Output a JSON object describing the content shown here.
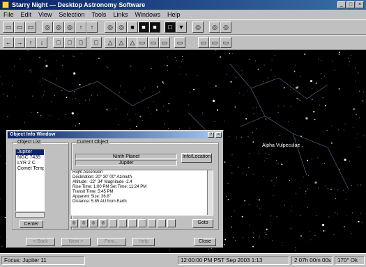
{
  "window": {
    "title": "Starry Night — Desktop Astronomy Software"
  },
  "menu": [
    "File",
    "Edit",
    "View",
    "Selection",
    "Tools",
    "Links",
    "Windows",
    "Help"
  ],
  "toolbar1": [
    "▭",
    "▭",
    "▭",
    "◎",
    "◎",
    "◎",
    "↑",
    "↑",
    "◎",
    "◎",
    "■",
    "■",
    "■",
    "□",
    "▼",
    "◎",
    "◎",
    "◎"
  ],
  "toolbar2": [
    "←",
    "→",
    "↑",
    "↓",
    "□",
    "□",
    "□",
    "□",
    "△",
    "△",
    "△",
    "▭",
    "▭",
    "▭",
    "▭",
    "▭",
    "▭",
    "▭"
  ],
  "sky": {
    "labels": [
      {
        "text": "Alpha Vulpeculae"
      }
    ]
  },
  "status": {
    "left": "Focus: Jupiter 11",
    "middle": "12:00:00 PM PST  Sep 2003 1:13",
    "right": "2 07h 00m 00s",
    "zoom": "170° Ok"
  },
  "dialog": {
    "title": "Object Info Window",
    "list_label": "Object List",
    "list_items": [
      "Jupiter",
      "NGC 7435",
      "LYR 2 C",
      "Comet Tempel"
    ],
    "selected_index": 0,
    "center_button": "Center",
    "group_label": "Current Object",
    "object_name": "Ninth Planet",
    "object_type": "Jupiter",
    "info_button": "Info/Location",
    "info_lines": [
      "Right Ascension",
      "Declination: 20° 30' 00\"  Azimuth",
      "Altitude:  -22° 34'  Magnitude -2.4",
      "Rise Time: 1:00 PM  Set Time: 11:24 PM",
      "Transit Time: 5:45 PM",
      "Apparent Size: 36.8\"",
      "Distance: 5.85 AU from Earth"
    ],
    "tool_icons": [
      "◎",
      "◎",
      "◎",
      "◎",
      "",
      "",
      "",
      "",
      "",
      "",
      ""
    ],
    "goto_button": "Goto",
    "nav_buttons": [
      "< Back",
      "Next >",
      "Print...",
      "Help"
    ],
    "close_button": "Close"
  },
  "colors": {
    "title_dark": "#0a246a",
    "title_light": "#a6caf0",
    "face": "#c0c0c0",
    "sky": "#000000"
  }
}
